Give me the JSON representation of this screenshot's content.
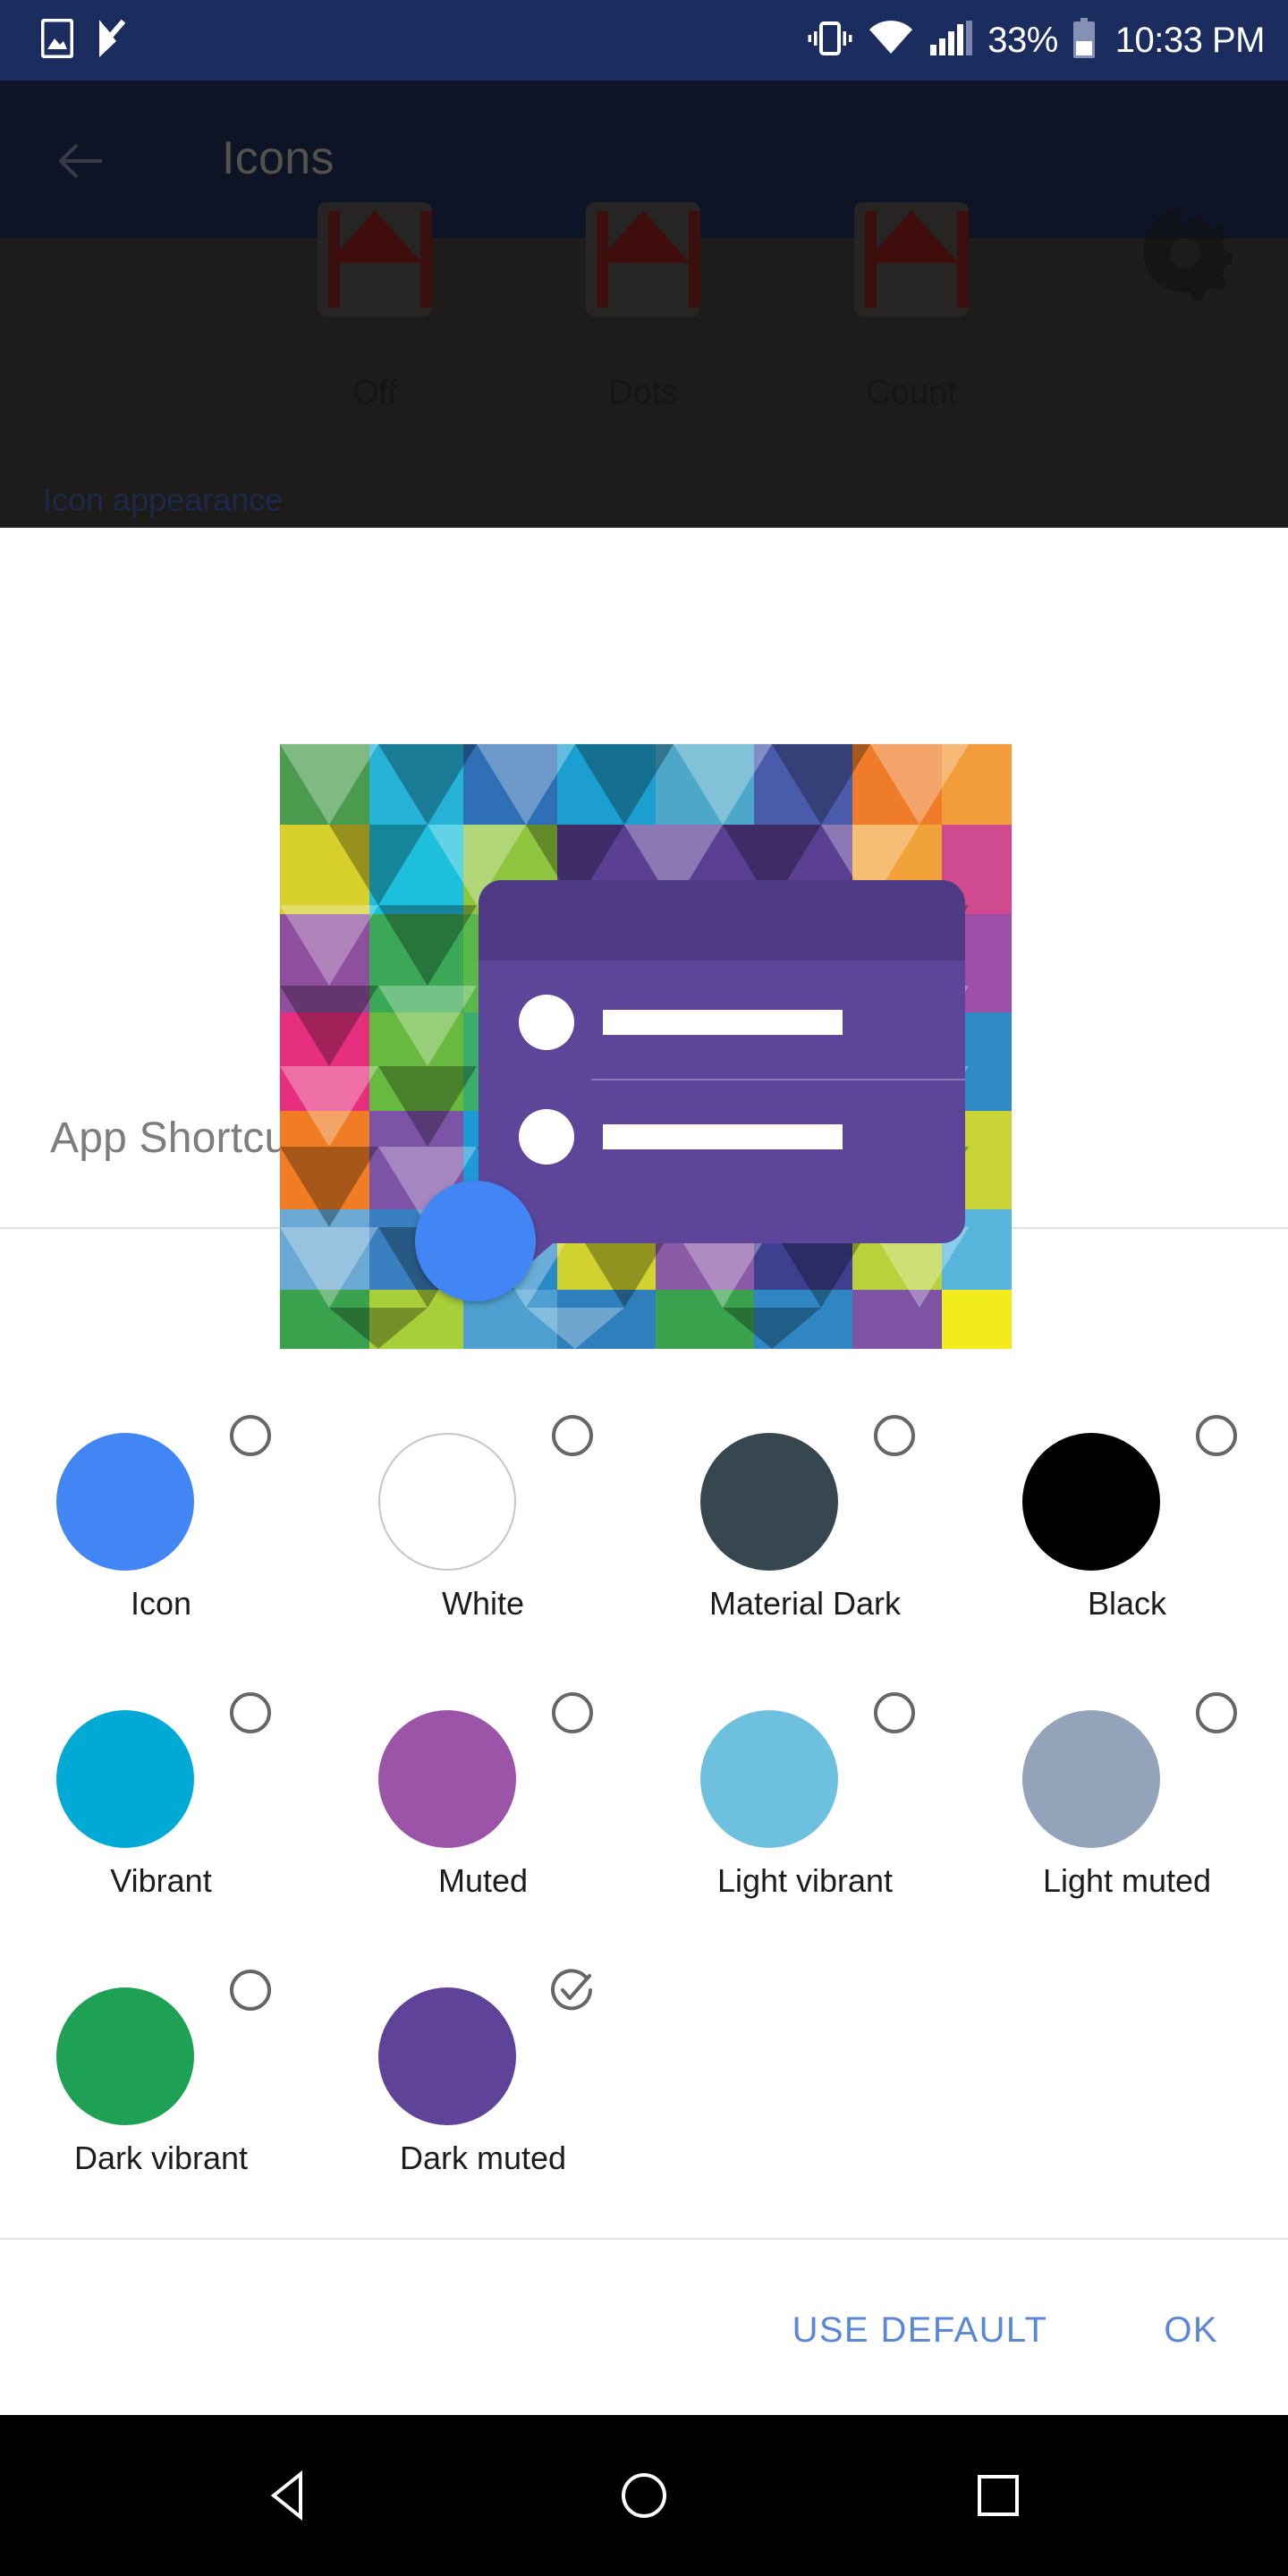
{
  "status_bar": {
    "background_color": "#1b2c5e",
    "left_icons": [
      "image-icon",
      "check-badge-icon"
    ],
    "right_icons": [
      "vibrate-icon",
      "wifi-icon",
      "signal-icon"
    ],
    "battery_percent": "33%",
    "battery_icon": "battery-icon",
    "time": "10:33 PM"
  },
  "background_activity": {
    "back_icon": "back-arrow-icon",
    "title": "Icons",
    "badge_options": [
      "Off",
      "Dots",
      "Count"
    ],
    "gear_icon": "gear-icon",
    "section_label": "Icon appearance",
    "section_label_color": "#1b2a4a",
    "toolbar_color": "#0d1426",
    "body_color": "#1d1c1b"
  },
  "dialog": {
    "title": "App Shortcuts",
    "title_color": "#7d7d7d",
    "preview": {
      "name": "app-shortcut-preview",
      "card_color": "#5d4699",
      "card_header_color": "#4f3a85",
      "icon_circle_color": "#4285f4",
      "rows": 2
    },
    "swatches": [
      {
        "label": "Icon",
        "color": "#4285f4",
        "selected": false,
        "bordered": false
      },
      {
        "label": "White",
        "color": "#ffffff",
        "selected": false,
        "bordered": true
      },
      {
        "label": "Material Dark",
        "color": "#37474f",
        "selected": false,
        "bordered": false
      },
      {
        "label": "Black",
        "color": "#000000",
        "selected": false,
        "bordered": false
      },
      {
        "label": "Vibrant",
        "color": "#00aad4",
        "selected": false,
        "bordered": false
      },
      {
        "label": "Muted",
        "color": "#9c54a8",
        "selected": false,
        "bordered": false
      },
      {
        "label": "Light vibrant",
        "color": "#6ec1de",
        "selected": false,
        "bordered": false
      },
      {
        "label": "Light muted",
        "color": "#93a3ba",
        "selected": false,
        "bordered": false
      },
      {
        "label": "Dark vibrant",
        "color": "#1ea155",
        "selected": false,
        "bordered": false
      },
      {
        "label": "Dark muted",
        "color": "#5f4399",
        "selected": true,
        "bordered": false
      }
    ],
    "actions": {
      "use_default_label": "USE DEFAULT",
      "ok_label": "OK",
      "accent_color": "#5b87d4"
    }
  },
  "nav_bar": {
    "background_color": "#000000",
    "buttons": [
      "back-triangle-icon",
      "home-circle-icon",
      "recents-square-icon"
    ]
  }
}
